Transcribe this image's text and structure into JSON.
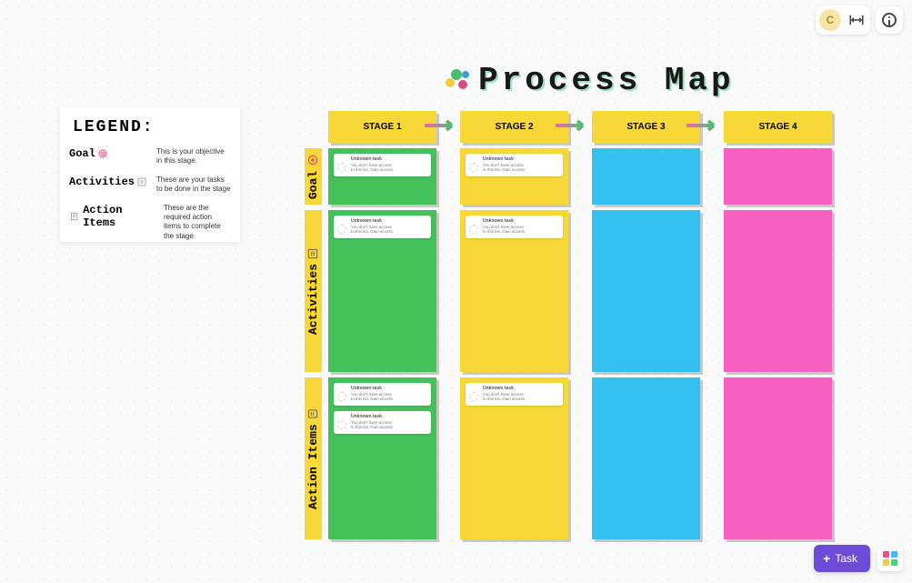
{
  "title": "Process Map",
  "avatar_initial": "C",
  "legend": {
    "title": "LEGEND:",
    "rows": [
      {
        "label": "Goal",
        "desc": "This is your objective in this stage."
      },
      {
        "label": "Activities",
        "desc": "These are your tasks to be done in the stage"
      },
      {
        "label": "Action Items",
        "desc": "These are the required action items to complete the stage"
      }
    ]
  },
  "stages": [
    "STAGE 1",
    "STAGE 2",
    "STAGE 3",
    "STAGE 4"
  ],
  "row_labels": [
    "Goal",
    "Activities",
    "Action Items"
  ],
  "task_card": {
    "title": "Unknown task",
    "desc1": "You don't have access",
    "desc2": "to this list. Gain access"
  },
  "task_button": "Task",
  "chart_data": {
    "type": "table",
    "title": "Process Map",
    "columns": [
      "STAGE 1",
      "STAGE 2",
      "STAGE 3",
      "STAGE 4"
    ],
    "row_headers": [
      "Goal",
      "Activities",
      "Action Items"
    ],
    "cell_colors": [
      [
        "green",
        "yellow",
        "blue",
        "pink"
      ],
      [
        "green",
        "yellow",
        "blue",
        "pink"
      ],
      [
        "green",
        "yellow",
        "blue",
        "pink"
      ]
    ],
    "task_counts": [
      [
        1,
        1,
        0,
        0
      ],
      [
        1,
        1,
        0,
        0
      ],
      [
        2,
        1,
        0,
        0
      ]
    ]
  }
}
